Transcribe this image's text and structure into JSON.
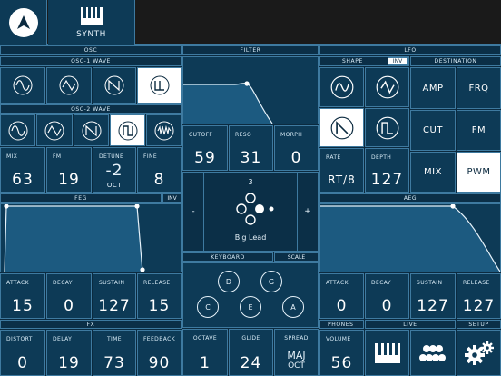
{
  "topbar": {
    "tab_label": "SYNTH"
  },
  "osc": {
    "title": "OSC",
    "osc1_title": "OSC-1 WAVE",
    "osc2_title": "OSC-2 WAVE",
    "params": [
      {
        "label": "MIX",
        "value": "63"
      },
      {
        "label": "FM",
        "value": "19"
      },
      {
        "label": "DETUNE",
        "value": "-2",
        "unit": "OCT"
      },
      {
        "label": "FINE",
        "value": "8"
      }
    ]
  },
  "filter": {
    "title": "FILTER",
    "params": [
      {
        "label": "CUTOFF",
        "value": "59"
      },
      {
        "label": "RESO",
        "value": "31"
      },
      {
        "label": "MORPH",
        "value": "0"
      }
    ]
  },
  "lfo": {
    "title": "LFO",
    "shape_title": "SHAPE",
    "inv_label": "INV",
    "destination_title": "DESTINATION",
    "destinations": [
      "AMP",
      "FRQ",
      "CUT",
      "FM",
      "MIX",
      "PWM"
    ],
    "rate_label": "RATE",
    "rate_value": "RT/8",
    "depth_label": "DEPTH",
    "depth_value": "127"
  },
  "feg": {
    "title": "FEG",
    "inv_label": "INV",
    "params": [
      {
        "label": "ATTACK",
        "value": "15"
      },
      {
        "label": "DECAY",
        "value": "0"
      },
      {
        "label": "SUSTAIN",
        "value": "127"
      },
      {
        "label": "RELEASE",
        "value": "15"
      }
    ]
  },
  "preset": {
    "number": "3",
    "name": "Big Lead",
    "minus_label": "-",
    "plus_label": "+"
  },
  "aeg": {
    "title": "AEG",
    "params": [
      {
        "label": "ATTACK",
        "value": "0"
      },
      {
        "label": "DECAY",
        "value": "0"
      },
      {
        "label": "SUSTAIN",
        "value": "127"
      },
      {
        "label": "RELEASE",
        "value": "127"
      }
    ]
  },
  "keyboard": {
    "title": "KEYBOARD",
    "scale_label": "SCALE",
    "keys": [
      "D",
      "G",
      "C",
      "E",
      "A"
    ],
    "params": [
      {
        "label": "OCTAVE",
        "value": "1"
      },
      {
        "label": "GLIDE",
        "value": "24"
      },
      {
        "label": "SPREAD",
        "value": "MAJ",
        "unit": "OCT"
      }
    ]
  },
  "fx": {
    "title": "FX",
    "params": [
      {
        "label": "DISTORT",
        "value": "0"
      },
      {
        "label": "DELAY",
        "value": "19"
      },
      {
        "label": "TIME",
        "value": "73"
      },
      {
        "label": "FEEDBACK",
        "value": "90"
      }
    ]
  },
  "bottom_right": {
    "phones_title": "PHONES",
    "volume_label": "VOLUME",
    "volume_value": "56",
    "live_title": "LIVE",
    "setup_title": "SETUP"
  },
  "colors": {
    "background": "#0b2a3f",
    "panel": "#0d3a56",
    "border": "#3e7aa0",
    "selected": "#ffffff",
    "topbar": "#1a1a1a"
  }
}
